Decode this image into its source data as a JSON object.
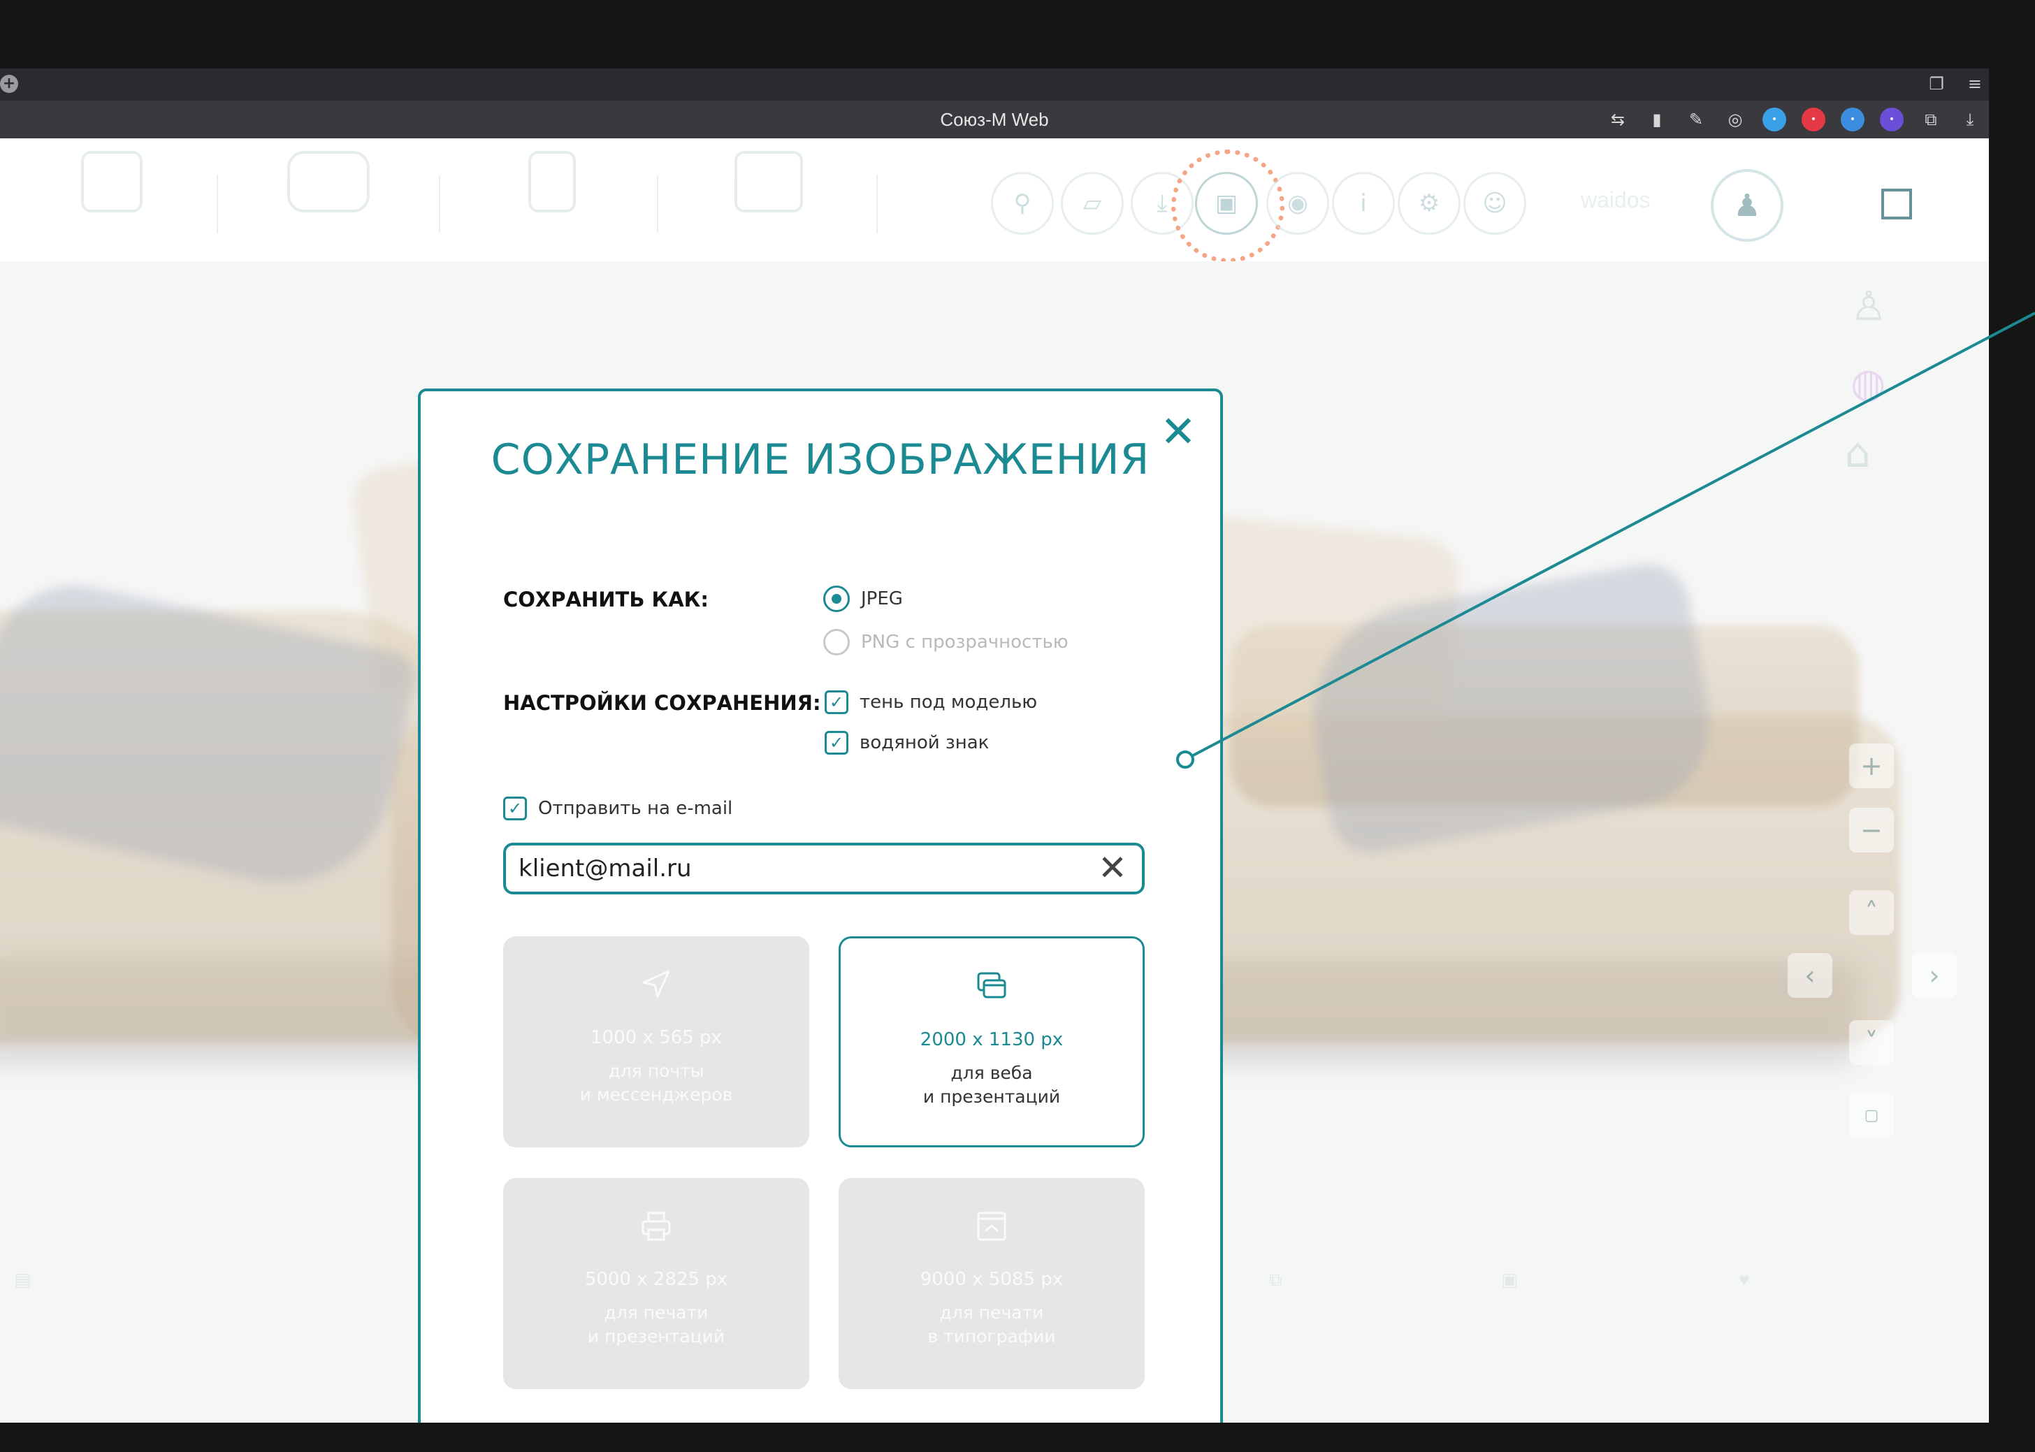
{
  "browser": {
    "window_title": "Союз-М Web"
  },
  "app": {
    "username": "waidos"
  },
  "dialog": {
    "title": "СОХРАНЕНИЕ ИЗОБРАЖЕНИЯ",
    "save_as_label": "СОХРАНИТЬ КАК:",
    "format_options": [
      {
        "label": "JPEG",
        "selected": true
      },
      {
        "label": "PNG с прозрачностью",
        "selected": false
      }
    ],
    "settings_label": "НАСТРОЙКИ СОХРАНЕНИЯ:",
    "settings": [
      {
        "label": "тень под моделью",
        "checked": true
      },
      {
        "label": "водяной знак",
        "checked": true
      }
    ],
    "send_email_label": "Отправить на e-mail",
    "send_email_checked": true,
    "email_value": "klient@mail.ru",
    "sizes": [
      {
        "resolution": "1000 x 565 px",
        "line1": "для почты",
        "line2": "и мессенджеров",
        "icon": "send-icon",
        "selected": false
      },
      {
        "resolution": "2000 x 1130 px",
        "line1": "для веба",
        "line2": "и презентаций",
        "icon": "windows-icon",
        "selected": true
      },
      {
        "resolution": "5000 x 2825 px",
        "line1": "для печати",
        "line2": "и презентаций",
        "icon": "printer-icon",
        "selected": false
      },
      {
        "resolution": "9000 x 5085 px",
        "line1": "для печати",
        "line2": "в типографии",
        "icon": "poster-icon",
        "selected": false
      }
    ]
  },
  "colors": {
    "accent": "#1b8a93",
    "highlight_ring": "#f07a4d"
  }
}
